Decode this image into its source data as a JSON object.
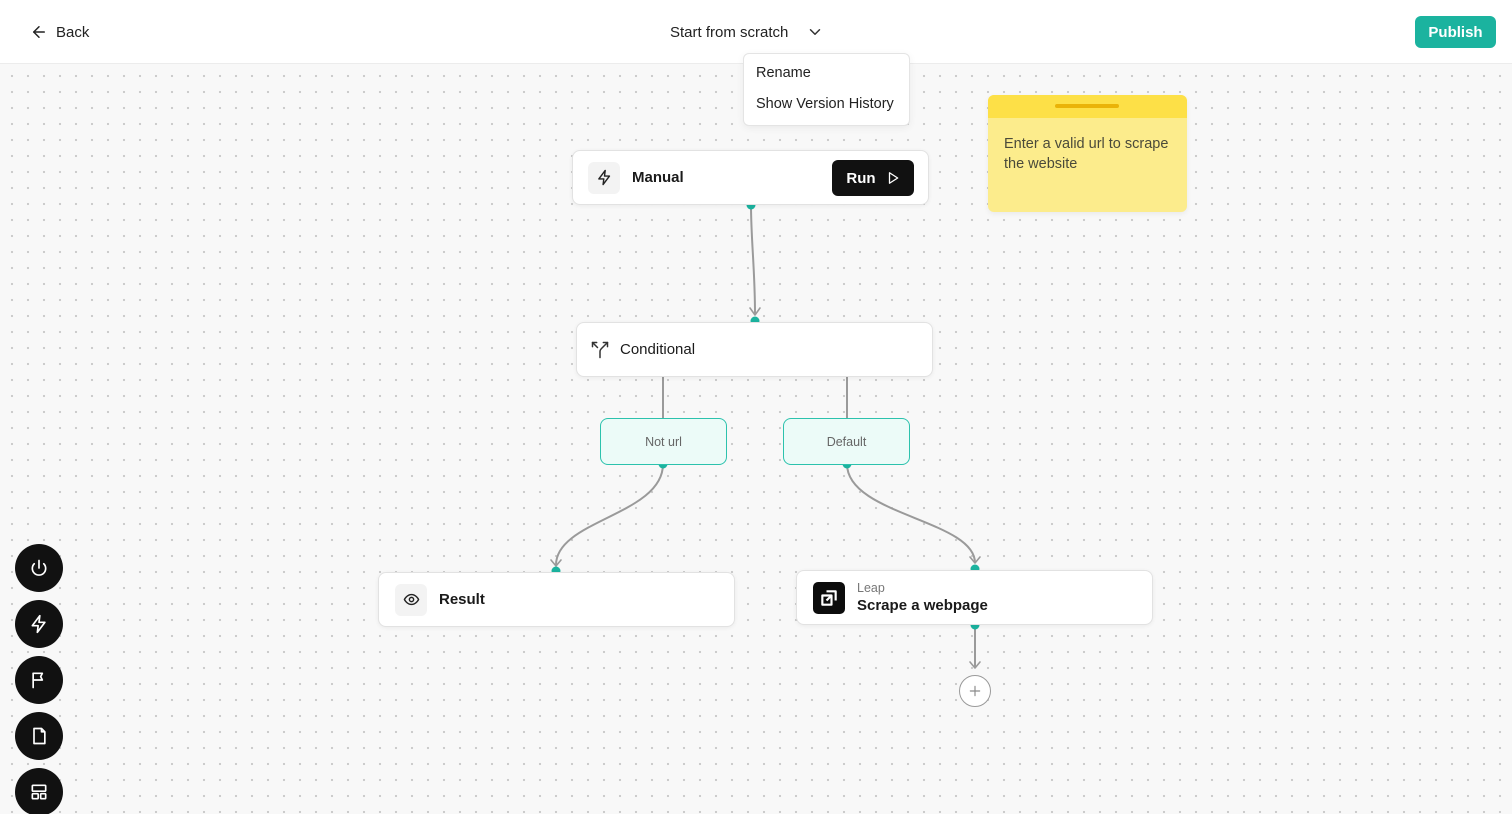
{
  "header": {
    "back_label": "Back",
    "flow_title": "Start from scratch",
    "publish_label": "Publish"
  },
  "title_menu": {
    "items": [
      "Rename",
      "Show Version History"
    ]
  },
  "sticky_note": {
    "text": "Enter a valid url to scrape the website"
  },
  "nodes": {
    "manual": {
      "label": "Manual",
      "run_label": "Run",
      "icon": "lightning-icon"
    },
    "conditional": {
      "label": "Conditional",
      "icon": "split-icon"
    },
    "branches": [
      "Not url",
      "Default"
    ],
    "result": {
      "label": "Result",
      "icon": "eye-icon"
    },
    "scrape": {
      "provider": "Leap",
      "label": "Scrape a webpage",
      "icon": "leap-logo"
    }
  },
  "toolbar": {
    "tools": [
      "power-icon",
      "lightning-icon",
      "flag-icon",
      "file-icon",
      "layout-icon"
    ]
  },
  "colors": {
    "accent": "#1bb39f",
    "branch_fill": "#ecfbf8",
    "sticky_body": "#fcec8c",
    "sticky_header": "#fde047",
    "run_button": "#111111"
  }
}
